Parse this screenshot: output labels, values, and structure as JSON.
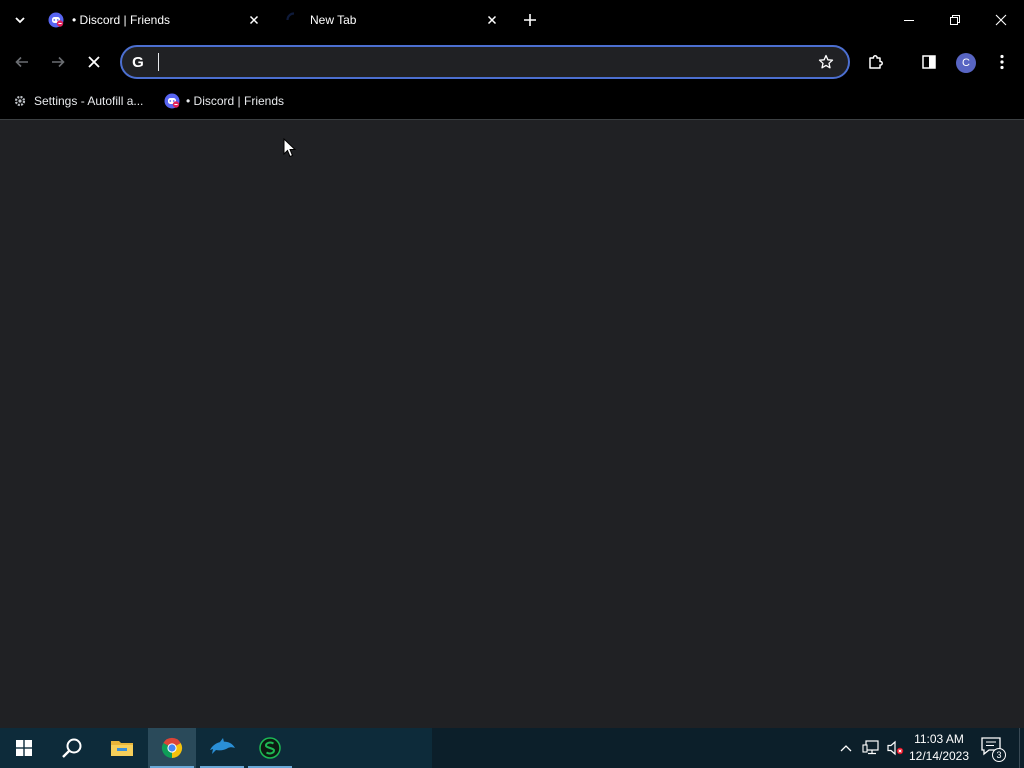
{
  "tabs": [
    {
      "title": "• Discord | Friends",
      "favicon": "discord-icon"
    },
    {
      "title": "New Tab",
      "favicon": "loading-spinner-icon"
    }
  ],
  "omnibox": {
    "value": "",
    "placeholder": ""
  },
  "profile": {
    "initial": "C"
  },
  "bookmarks": [
    {
      "label": "Settings - Autofill a...",
      "icon": "gear-icon"
    },
    {
      "label": "• Discord | Friends",
      "icon": "discord-icon"
    }
  ],
  "clock": {
    "time": "11:03 AM",
    "date": "12/14/2023"
  },
  "notifications": {
    "count": "3"
  },
  "colors": {
    "accent": "#4c6fd0",
    "discord": "#5865f2",
    "badge": "#e0245e"
  }
}
